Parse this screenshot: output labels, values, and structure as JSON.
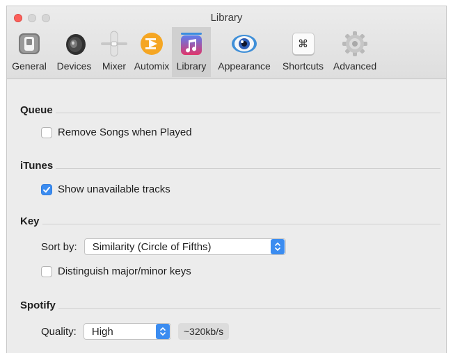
{
  "window": {
    "title": "Library"
  },
  "toolbar": {
    "items": [
      {
        "label": "General",
        "icon": "switch-icon"
      },
      {
        "label": "Devices",
        "icon": "speaker-icon"
      },
      {
        "label": "Mixer",
        "icon": "mixer-slider-icon"
      },
      {
        "label": "Automix",
        "icon": "automix-play-icon"
      },
      {
        "label": "Library",
        "icon": "music-note-icon",
        "active": true
      },
      {
        "label": "Appearance",
        "icon": "eye-icon"
      },
      {
        "label": "Shortcuts",
        "icon": "command-key-icon"
      },
      {
        "label": "Advanced",
        "icon": "gear-icon"
      }
    ],
    "shortcut_glyph": "⌘"
  },
  "queue": {
    "heading": "Queue",
    "remove_songs_label": "Remove Songs when Played",
    "remove_songs_checked": false
  },
  "itunes": {
    "heading": "iTunes",
    "show_unavailable_label": "Show unavailable tracks",
    "show_unavailable_checked": true
  },
  "key": {
    "heading": "Key",
    "sort_by_label": "Sort by:",
    "sort_by_value": "Similarity (Circle of Fifths)",
    "distinguish_label": "Distinguish major/minor keys",
    "distinguish_checked": false
  },
  "spotify": {
    "heading": "Spotify",
    "quality_label": "Quality:",
    "quality_value": "High",
    "bitrate": "~320kb/s"
  },
  "colors": {
    "accent": "#3b8cf0",
    "close": "#fc605b"
  }
}
